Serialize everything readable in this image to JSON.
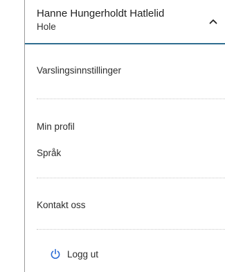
{
  "user": {
    "name": "Hanne Hungerholdt Hatlelid",
    "location": "Hole"
  },
  "menu": {
    "notification_settings": "Varslingsinnstillinger",
    "my_profile": "Min profil",
    "language": "Språk",
    "contact_us": "Kontakt oss",
    "logout": "Logg ut"
  },
  "icons": {
    "chevron": "chevron-up-icon",
    "logout": "power-icon"
  },
  "colors": {
    "accent": "#2f6d8f",
    "power_icon": "#2a6bd6"
  }
}
